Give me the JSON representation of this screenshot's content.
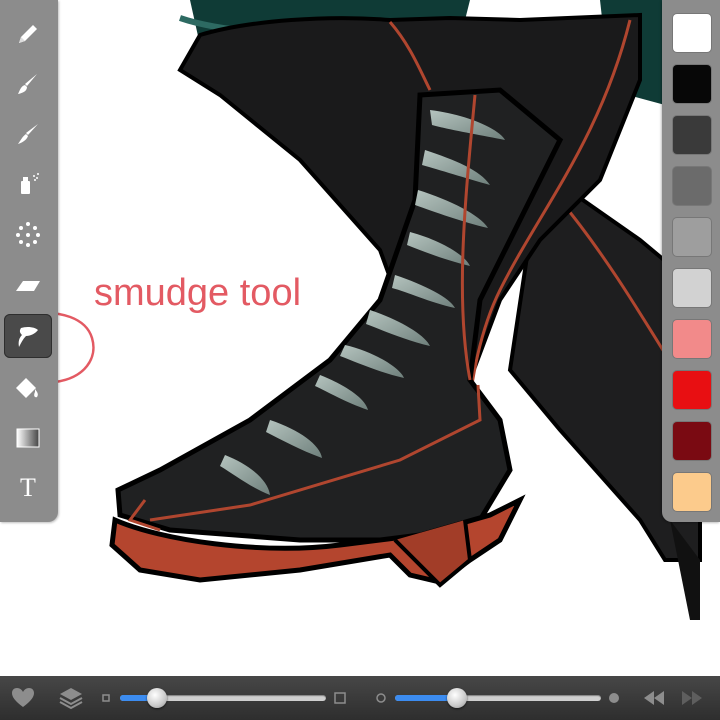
{
  "annotation": {
    "text": "smudge tool",
    "color": "#e35a63"
  },
  "toolbar": {
    "tools": [
      {
        "icon": "pencil-icon"
      },
      {
        "icon": "brush-icon"
      },
      {
        "icon": "ink-brush-icon"
      },
      {
        "icon": "airbrush-icon"
      },
      {
        "icon": "scatter-brush-icon"
      },
      {
        "icon": "eraser-icon"
      },
      {
        "icon": "smudge-icon",
        "selected": true
      },
      {
        "icon": "fill-bucket-icon"
      },
      {
        "icon": "gradient-icon"
      },
      {
        "icon": "text-tool-icon",
        "glyph": "T"
      }
    ]
  },
  "palette": {
    "colors": [
      "#ffffff",
      "#070707",
      "#3a3a3a",
      "#6b6b6b",
      "#9e9e9e",
      "#d2d2d2",
      "#f28a8a",
      "#e80f12",
      "#7a0a12",
      "#fccb8c"
    ]
  },
  "bottombar": {
    "icons": [
      "heart-icon",
      "layers-icon",
      "brush-size-small-icon",
      "brush-size-large-icon",
      "opacity-low-icon",
      "opacity-high-icon",
      "undo-icon",
      "redo-icon"
    ],
    "size_slider_fraction": 0.18,
    "opacity_slider_fraction": 0.3,
    "accent": "#3c8cf0"
  }
}
